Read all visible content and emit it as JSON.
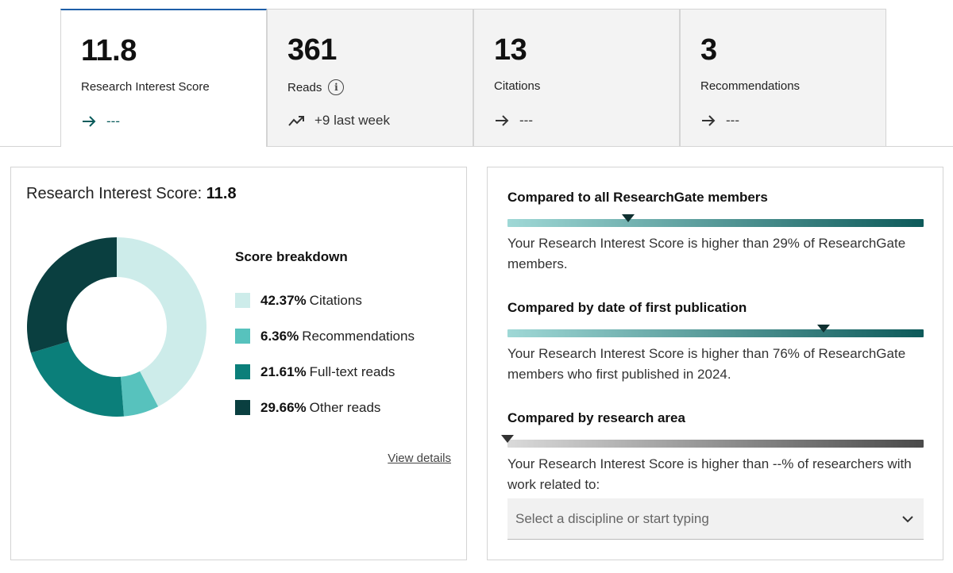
{
  "tabs": [
    {
      "value": "11.8",
      "label": "Research Interest Score",
      "trend": "---",
      "trend_icon": "arrow-right-icon"
    },
    {
      "value": "361",
      "label": "Reads",
      "trend": "+9 last week",
      "trend_icon": "trending-up-icon"
    },
    {
      "value": "13",
      "label": "Citations",
      "trend": "---",
      "trend_icon": "arrow-right-icon"
    },
    {
      "value": "3",
      "label": "Recommendations",
      "trend": "---",
      "trend_icon": "arrow-right-icon"
    }
  ],
  "score_panel": {
    "title_label": "Research Interest Score:",
    "title_value": "11.8",
    "breakdown_title": "Score breakdown",
    "view_details": "View details",
    "items": [
      {
        "pct": "42.37%",
        "label": "Citations",
        "value": 42.37,
        "color": "#cdecea"
      },
      {
        "pct": "6.36%",
        "label": "Recommendations",
        "value": 6.36,
        "color": "#57c2bd"
      },
      {
        "pct": "21.61%",
        "label": "Full-text reads",
        "value": 21.61,
        "color": "#0b7f7a"
      },
      {
        "pct": "29.66%",
        "label": "Other reads",
        "value": 29.66,
        "color": "#0a3f40"
      }
    ]
  },
  "comparisons": [
    {
      "title": "Compared to all ResearchGate members",
      "text": "Your Research Interest Score is higher than 29% of ResearchGate members.",
      "position": 0.29
    },
    {
      "title": "Compared by date of first publication",
      "text": "Your Research Interest Score is higher than 76% of ResearchGate members who first published in 2024.",
      "position": 0.76
    },
    {
      "title": "Compared by research area",
      "text": "Your Research Interest Score is higher than --% of researchers with work related to:",
      "position": 0.0
    }
  ],
  "discipline_select": {
    "placeholder": "Select a discipline or start typing"
  },
  "colors": {
    "accent_tab": "#1d5ea8",
    "teal_dark": "#0d5a5a",
    "teal_light": "#9fd8d6"
  }
}
